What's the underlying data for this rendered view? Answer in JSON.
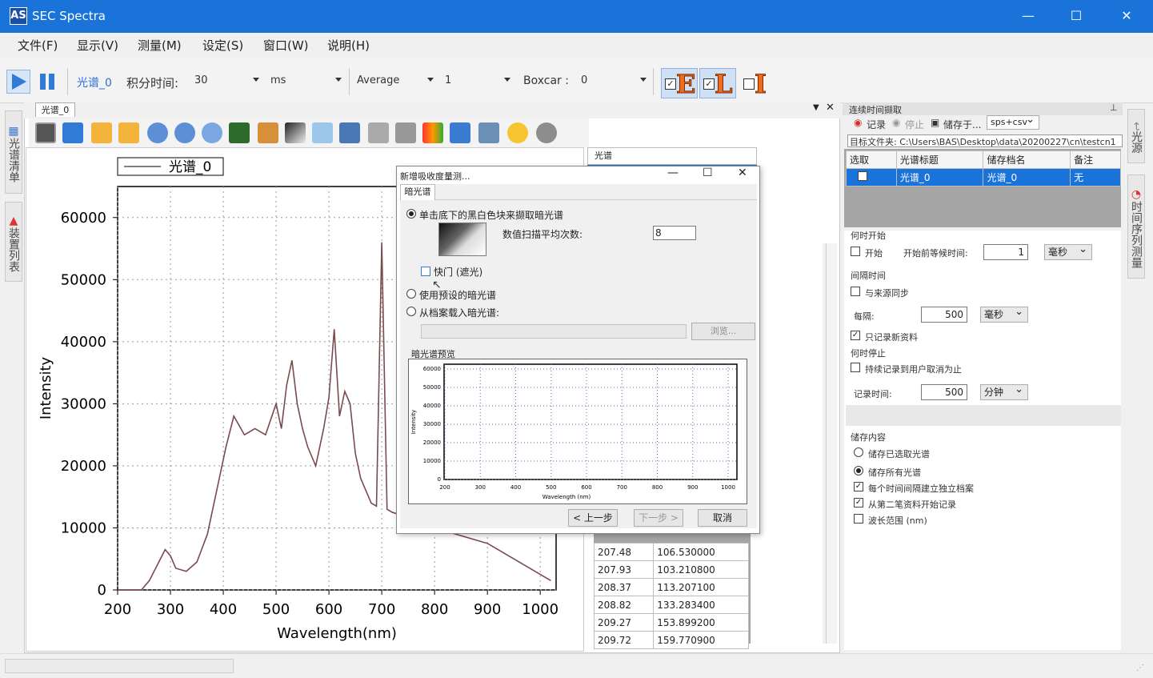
{
  "window": {
    "title": "SEC Spectra",
    "logo": "AS"
  },
  "menu": [
    "文件(F)",
    "显示(V)",
    "测量(M)",
    "设定(S)",
    "窗口(W)",
    "说明(H)"
  ],
  "toolbar": {
    "spectrum_name": "光谱_0",
    "integration_label": "积分时间:",
    "integration_value": "30",
    "integration_unit": "ms",
    "mode": "Average",
    "average_count": "1",
    "boxcar_label": "Boxcar :",
    "boxcar_value": "0",
    "eli": [
      "E",
      "L",
      "I"
    ],
    "eli_checked": [
      true,
      true,
      false
    ]
  },
  "left_tabs": [
    "光谱清单",
    "装置列表"
  ],
  "doc_tab": "光谱_0",
  "chart_data": {
    "type": "line",
    "legend": [
      "光谱_0"
    ],
    "xlabel": "Wavelength(nm)",
    "ylabel": "Intensity",
    "xlim": [
      200,
      1030
    ],
    "ylim": [
      0,
      65000
    ],
    "xticks": [
      200,
      300,
      400,
      500,
      600,
      700,
      800,
      900,
      1000
    ],
    "yticks": [
      0,
      10000,
      20000,
      30000,
      40000,
      50000,
      60000
    ],
    "grid": true,
    "series": [
      {
        "name": "光谱_0",
        "color": "#7b4a4f",
        "x": [
          200,
          245,
          260,
          275,
          290,
          300,
          310,
          330,
          350,
          370,
          385,
          395,
          405,
          420,
          440,
          460,
          480,
          500,
          510,
          520,
          530,
          540,
          550,
          560,
          575,
          590,
          600,
          610,
          620,
          630,
          640,
          650,
          660,
          670,
          680,
          690,
          700,
          710,
          720,
          740,
          760,
          780,
          800,
          820,
          840,
          860,
          880,
          900,
          920,
          940,
          960,
          980,
          1000,
          1020
        ],
        "y": [
          0,
          0,
          1500,
          4000,
          6500,
          5500,
          3500,
          3000,
          4500,
          9000,
          15000,
          19000,
          23000,
          28000,
          25000,
          26000,
          25000,
          30000,
          26000,
          33000,
          37000,
          30000,
          26000,
          23000,
          20000,
          26000,
          31000,
          42000,
          28000,
          32000,
          30000,
          22000,
          18000,
          16000,
          14000,
          13500,
          56000,
          13000,
          12500,
          12000,
          11500,
          10500,
          10000,
          9500,
          9000,
          8500,
          8000,
          7500,
          6500,
          5500,
          4500,
          3500,
          2500,
          1500
        ]
      }
    ]
  },
  "spec_list": {
    "header": "光谱",
    "rows": [
      [
        "207.48",
        "106.530000"
      ],
      [
        "207.93",
        "103.210800"
      ],
      [
        "208.37",
        "113.207100"
      ],
      [
        "208.82",
        "133.283400"
      ],
      [
        "209.27",
        "153.899200"
      ],
      [
        "209.72",
        "159.770900"
      ]
    ]
  },
  "dialog": {
    "title": "新增吸收度量测...",
    "tab": "暗光谱",
    "opt1": "单击底下的黑白色块来撷取暗光谱",
    "scan_avg_label": "数值扫描平均次数:",
    "scan_avg_value": "8",
    "shutter_label": "快门 (遮光)",
    "opt2": "使用预设的暗光谱",
    "opt3": "从档案载入暗光谱:",
    "browse": "浏览...",
    "preview_label": "暗光谱预览",
    "preview_chart": {
      "xticks": [
        "200",
        "300",
        "400",
        "500",
        "600",
        "700",
        "800",
        "900",
        "1000"
      ],
      "yticks": [
        "0",
        "10000",
        "20000",
        "30000",
        "40000",
        "50000",
        "60000"
      ],
      "xlabel": "Wavelength (nm)",
      "ylabel": "Intensity"
    },
    "prev": "< 上一步",
    "next": "下一步 >",
    "cancel": "取消"
  },
  "right": {
    "title": "连续时间撷取",
    "record": "记录",
    "stop": "停止",
    "save_to": "储存于...",
    "format": "sps+csv",
    "target_folder": "目标文件夹: C:\\Users\\BAS\\Desktop\\data\\20200227\\cn\\testcn1",
    "table_headers": [
      "选取",
      "光谱标题",
      "储存档名",
      "备注"
    ],
    "table_row": [
      "",
      "光谱_0",
      "光谱_0",
      "无"
    ],
    "when_start": "何时开始",
    "start_label": "开始",
    "wait_label": "开始前等候时间:",
    "wait_value": "1",
    "wait_unit": "毫秒",
    "interval": "间隔时间",
    "sync_label": "与来源同步",
    "every_label": "每隔:",
    "every_value": "500",
    "every_unit": "毫秒",
    "only_new": "只记录新资料",
    "when_stop": "何时停止",
    "until_cancel": "持续记录到用户取消为止",
    "record_time_label": "记录时间:",
    "record_time_value": "500",
    "record_time_unit": "分钟",
    "save_content": "储存内容",
    "save_selected": "储存已选取光谱",
    "save_all": "储存所有光谱",
    "per_interval": "每个时间间隔建立独立档案",
    "from_second": "从第二笔资料开始记录",
    "wavelength_range": "波长范围 (nm)"
  },
  "right_tabs": [
    "光源",
    "时间序列测量"
  ]
}
